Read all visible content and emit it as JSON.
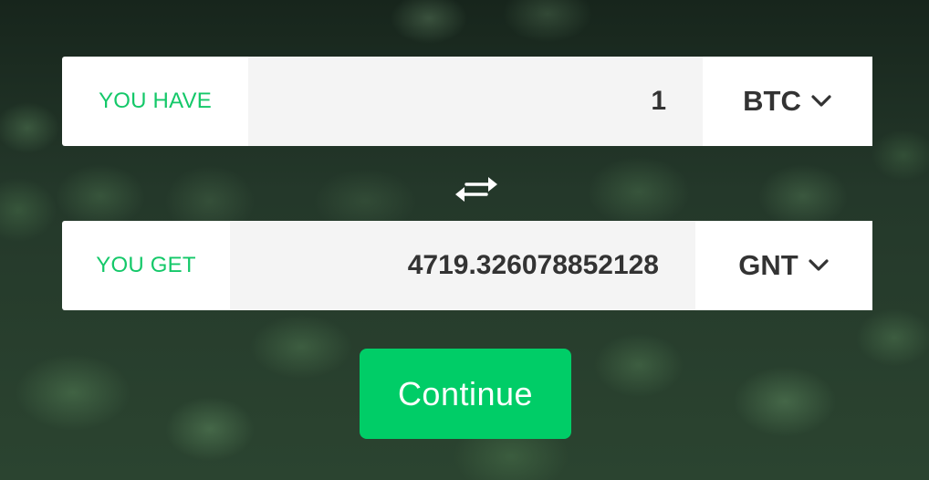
{
  "have": {
    "label": "YOU HAVE",
    "amount": "1",
    "currency": "BTC",
    "dropdown_icon": "chevron-down-icon"
  },
  "get": {
    "label": "YOU GET",
    "amount": "4719.326078852128",
    "currency": "GNT",
    "dropdown_icon": "chevron-down-icon"
  },
  "swap": {
    "icon": "swap-arrows-icon"
  },
  "continue": {
    "label": "Continue"
  },
  "colors": {
    "accent": "#00cd67",
    "label_text": "#14c869",
    "value_text": "#333333"
  }
}
